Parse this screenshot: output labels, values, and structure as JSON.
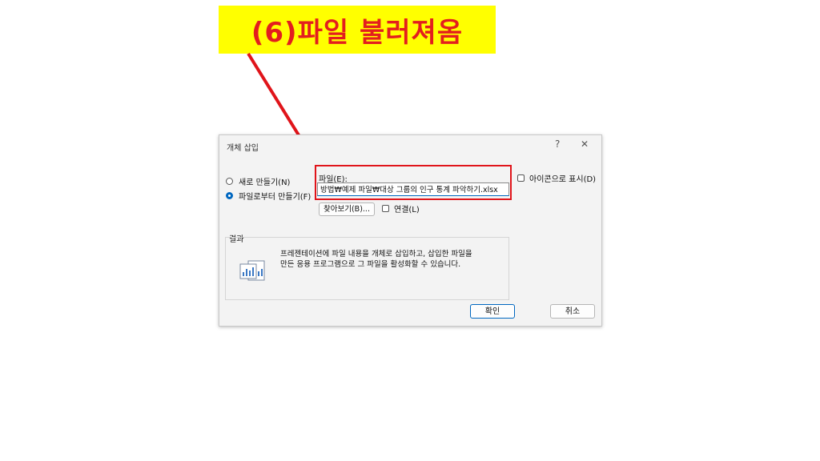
{
  "banner": {
    "text": "(6)파일 불러져옴"
  },
  "dialog": {
    "title": "개체 삽입",
    "help_label": "?",
    "close_label": "✕",
    "options": [
      {
        "label": "새로 만들기(N)",
        "selected": false
      },
      {
        "label": "파일로부터 만들기(F)",
        "selected": true
      }
    ],
    "file_label": "파일(E):",
    "file_value": "방법₩예제 파일₩대상 그룹의 인구 통계 파악하기.xlsx",
    "browse_label": "찾아보기(B)...",
    "link_label": "연결(L)",
    "icon_label": "아이콘으로 표시(D)",
    "result_label": "결과",
    "result_text_line1": "프레젠테이션에 파일 내용을 개체로 삽입하고, 삽입한 파일을",
    "result_text_line2": "만든 응용 프로그램으로 그 파일을 활성화할 수 있습니다.",
    "ok_label": "확인",
    "cancel_label": "취소"
  },
  "colors": {
    "banner_bg": "#ffff00",
    "annotation_red": "#e31e1e",
    "accent": "#0067c0"
  }
}
